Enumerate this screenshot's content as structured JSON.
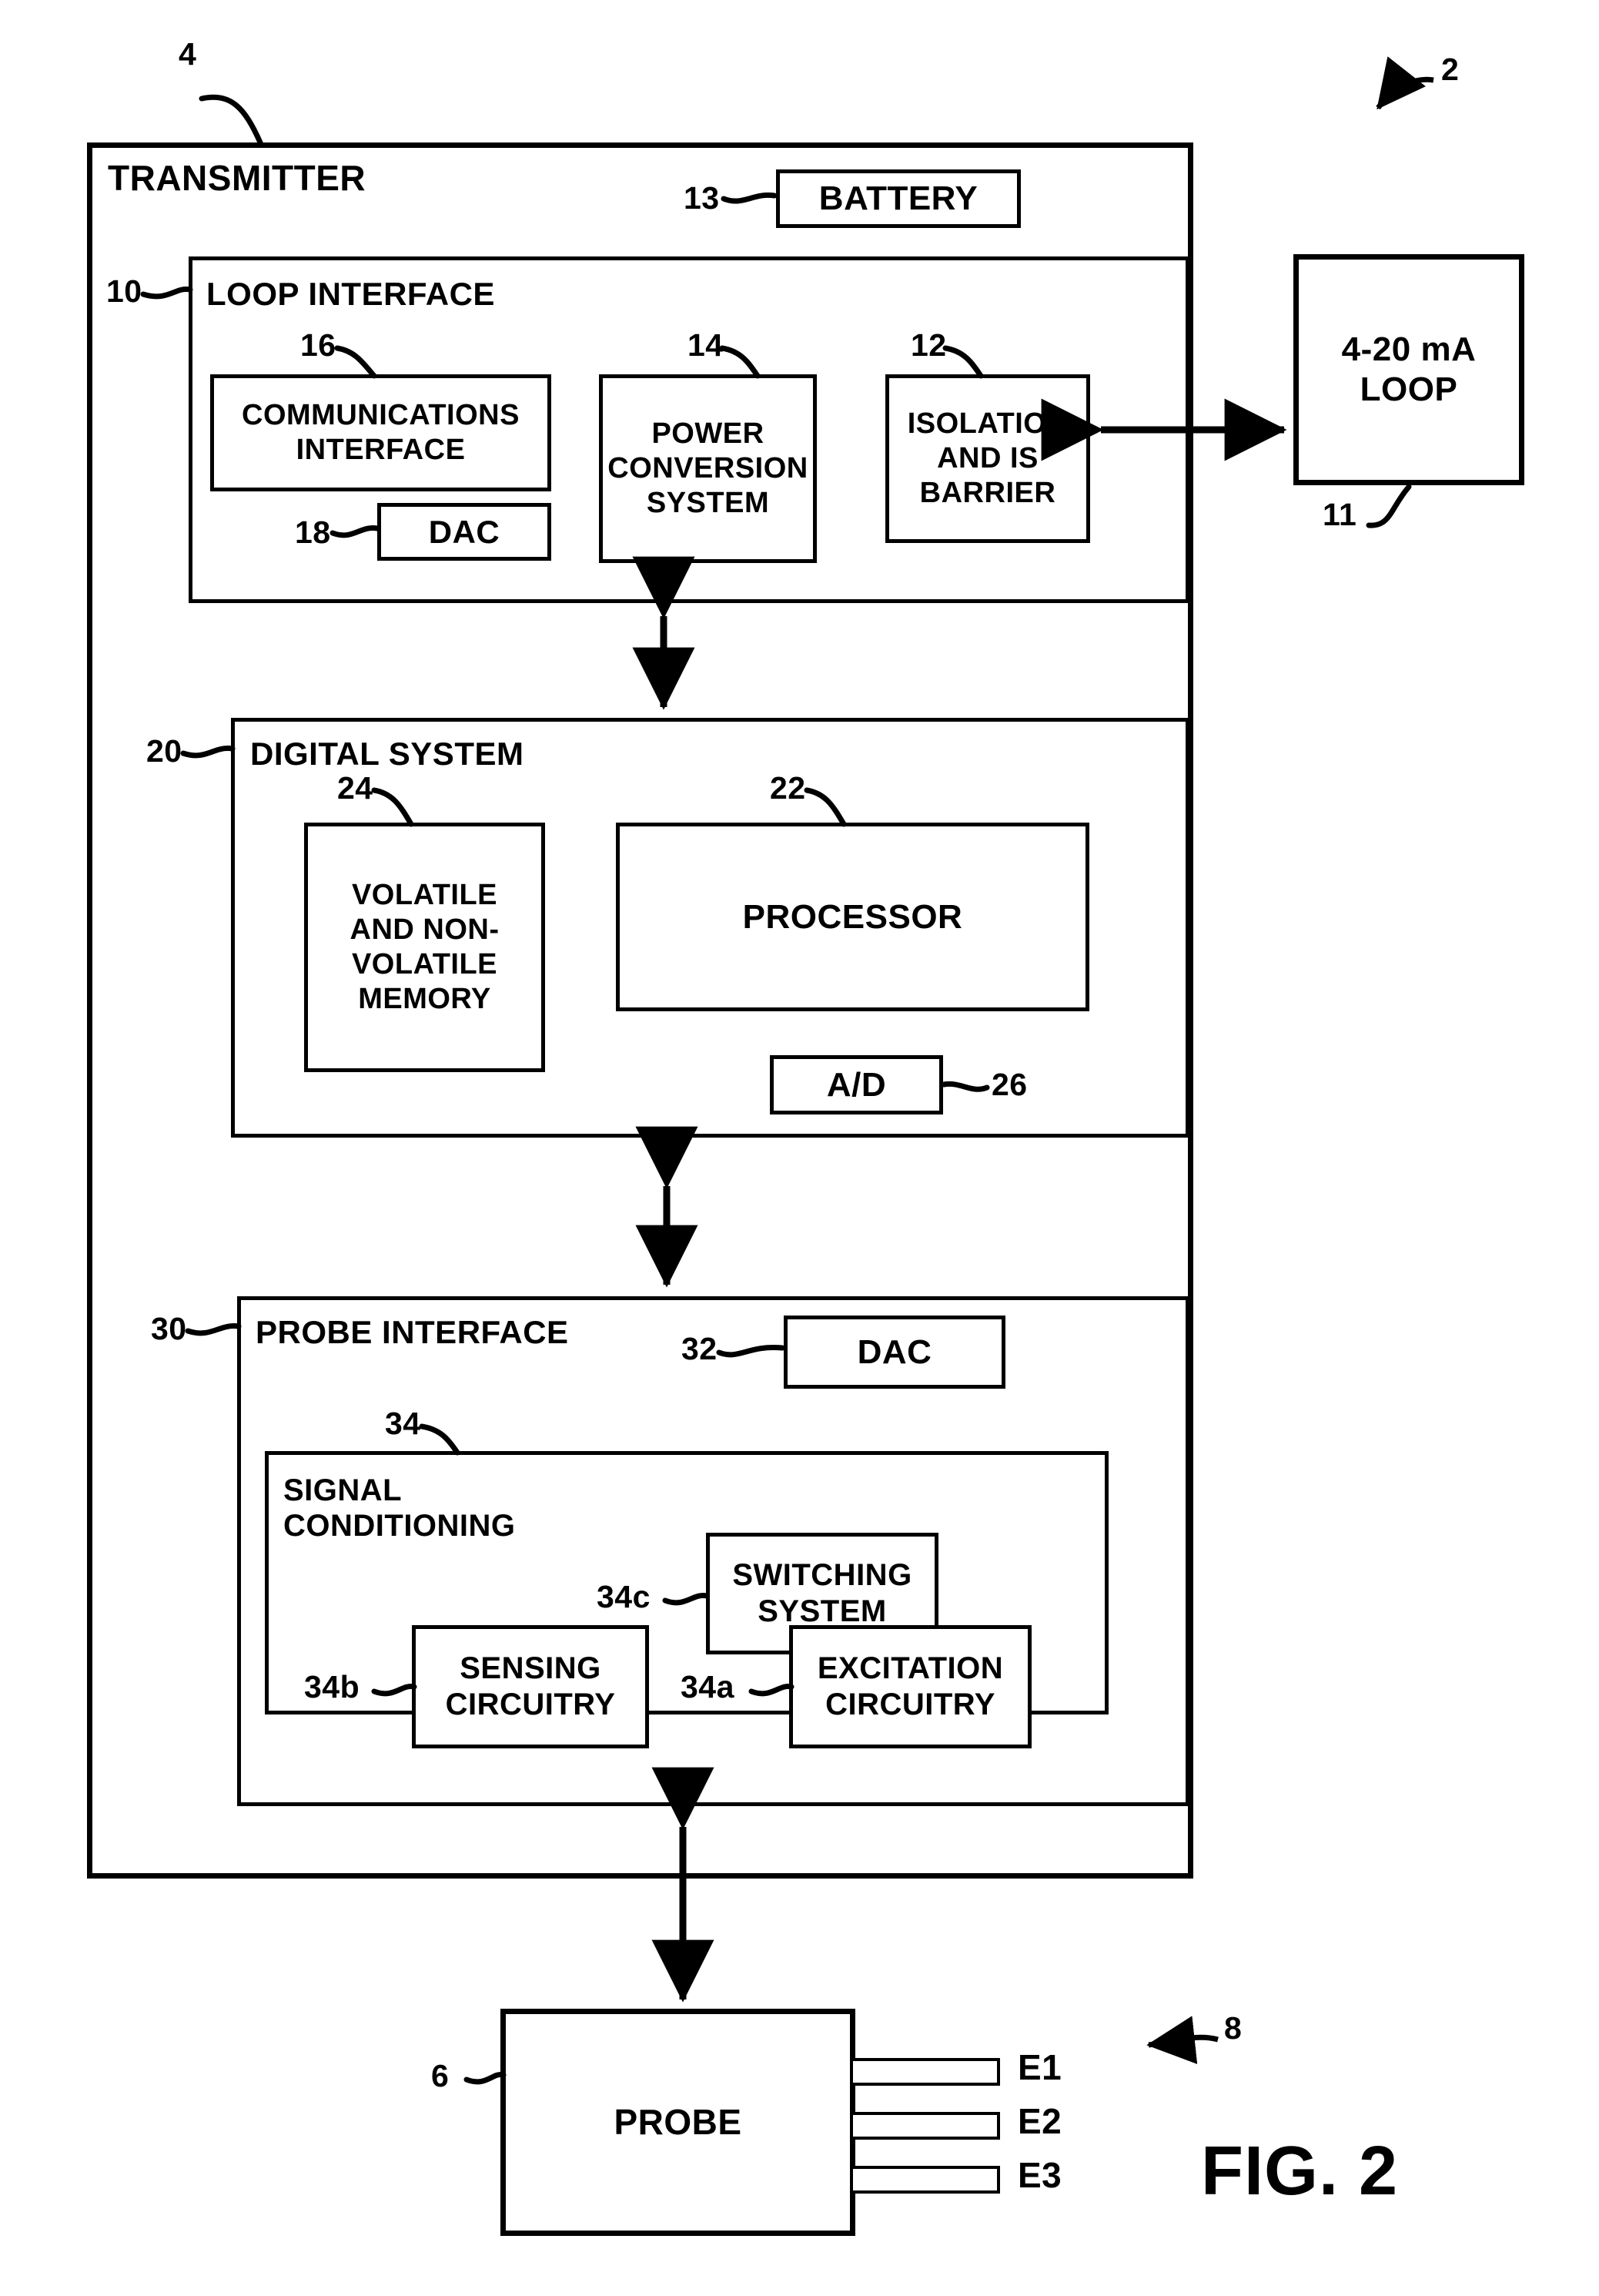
{
  "figure": {
    "label": "FIG. 2",
    "ref_system": "2",
    "ref_probe_assembly": "8"
  },
  "transmitter": {
    "title": "TRANSMITTER",
    "ref": "4",
    "battery": {
      "label": "BATTERY",
      "ref": "13"
    },
    "loop_interface": {
      "title": "LOOP INTERFACE",
      "ref": "10",
      "communications_interface": {
        "label": "COMMUNICATIONS\nINTERFACE",
        "ref": "16"
      },
      "dac": {
        "label": "DAC",
        "ref": "18"
      },
      "power_conversion": {
        "label": "POWER\nCONVERSION\nSYSTEM",
        "ref": "14"
      },
      "isolation": {
        "label": "ISOLATION\nAND IS\nBARRIER",
        "ref": "12"
      }
    },
    "digital_system": {
      "title": "DIGITAL SYSTEM",
      "ref": "20",
      "memory": {
        "label": "VOLATILE\nAND NON-\nVOLATILE\nMEMORY",
        "ref": "24"
      },
      "processor": {
        "label": "PROCESSOR",
        "ref": "22"
      },
      "adc": {
        "label": "A/D",
        "ref": "26"
      }
    },
    "probe_interface": {
      "title": "PROBE INTERFACE",
      "ref": "30",
      "dac": {
        "label": "DAC",
        "ref": "32"
      },
      "signal_conditioning": {
        "title": "SIGNAL\nCONDITIONING",
        "ref": "34",
        "switching_system": {
          "label": "SWITCHING\nSYSTEM",
          "ref": "34c"
        },
        "sensing_circuitry": {
          "label": "SENSING\nCIRCUITRY",
          "ref": "34b"
        },
        "excitation_circuitry": {
          "label": "EXCITATION\nCIRCUITRY",
          "ref": "34a"
        }
      }
    }
  },
  "loop": {
    "label": "4-20 mA\nLOOP",
    "ref": "11"
  },
  "probe": {
    "label": "PROBE",
    "ref": "6",
    "electrodes": [
      {
        "label": "E1"
      },
      {
        "label": "E2"
      },
      {
        "label": "E3"
      }
    ]
  },
  "colors": {
    "ink": "#000000",
    "paper": "#ffffff"
  }
}
